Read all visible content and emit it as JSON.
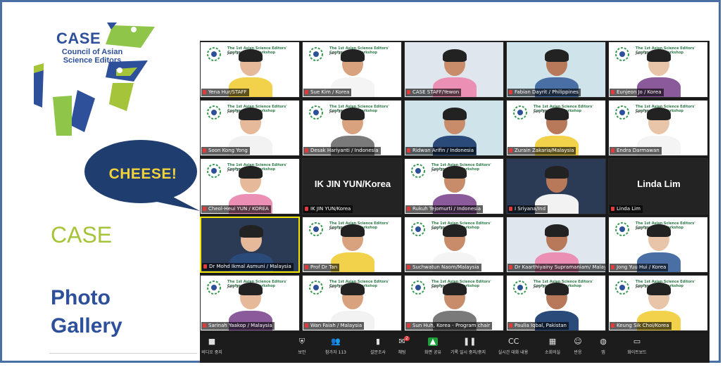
{
  "branding": {
    "logo_title": "CASE",
    "logo_subtitle": "Council of Asian Science Editors",
    "bubble_text": "CHEESE!",
    "case_heading": "CASE",
    "photo_line1": "Photo",
    "photo_line2": "Gallery"
  },
  "tiles": [
    {
      "name": "Yena Hur/STAFF",
      "kind": "slide",
      "speaker": false
    },
    {
      "name": "Sue Kim / Korea",
      "kind": "slide",
      "speaker": false
    },
    {
      "name": "CASE STAFF/Yewon",
      "kind": "photo",
      "speaker": false
    },
    {
      "name": "Fabian Dayrit / Philippines",
      "kind": "photo",
      "speaker": false
    },
    {
      "name": "Eunjeon Jo / Korea",
      "kind": "slide",
      "speaker": false
    },
    {
      "name": "Soon Kong Yong",
      "kind": "slide",
      "speaker": false
    },
    {
      "name": "Desak Hariyanti / Indonesia",
      "kind": "slide",
      "speaker": false
    },
    {
      "name": "Ridwan Arifin / Indonesia",
      "kind": "photo",
      "speaker": false
    },
    {
      "name": "Zurain Zakaria/Malaysia",
      "kind": "slide",
      "speaker": false
    },
    {
      "name": "Endra Darmawan",
      "kind": "slide",
      "speaker": false
    },
    {
      "name": "Cheol-Heui YUN / KOREA",
      "kind": "slide",
      "speaker": false
    },
    {
      "name": "IK JIN YUN/Korea",
      "kind": "dark",
      "speaker": false,
      "big": "IK JIN YUN/Korea"
    },
    {
      "name": "Rukuh Tejomurti / Indonesia",
      "kind": "slide",
      "speaker": false
    },
    {
      "name": "I Sriyana/Ind",
      "kind": "dark-photo",
      "speaker": false
    },
    {
      "name": "Linda Lim",
      "kind": "dark",
      "speaker": false,
      "big": "Linda Lim"
    },
    {
      "name": "Dr Mohd Ikmal Asmuni / Malaysia",
      "kind": "dark-photo",
      "speaker": true
    },
    {
      "name": "Prof Dr Tan",
      "kind": "slide",
      "speaker": false
    },
    {
      "name": "Suchwatun Naom/Malaysia",
      "kind": "slide",
      "speaker": false
    },
    {
      "name": "Dr Kaarthiyainy Supramaniam/ Malaysia",
      "kind": "photo",
      "speaker": false
    },
    {
      "name": "Jong Yuu Hui / Korea",
      "kind": "slide",
      "speaker": false
    },
    {
      "name": "Sarinah Yaakop / Malaysia",
      "kind": "slide",
      "speaker": false
    },
    {
      "name": "Wan Faiah / Malaysia",
      "kind": "slide",
      "speaker": false
    },
    {
      "name": "Sun Huh, Korea - Program chair",
      "kind": "slide",
      "speaker": false
    },
    {
      "name": "Paulia Iqbal, Pakistan",
      "kind": "slide",
      "speaker": false
    },
    {
      "name": "Keung Sik Choi/Korea",
      "kind": "slide",
      "speaker": false
    }
  ],
  "slide_text": {
    "header": "The 1st Asian Science Editors' Conference & Workshop",
    "date": "July 11, 2022",
    "small": "The 1st Asian Science Editors' Conference & Workshop"
  },
  "toolbar": {
    "items": [
      {
        "label": "비디오 중지",
        "icon": "video-icon",
        "glyph": "■"
      },
      {
        "label": "보안",
        "icon": "shield-icon",
        "glyph": "⛨"
      },
      {
        "label": "참가자 113",
        "icon": "participants-icon",
        "glyph": "👥"
      },
      {
        "label": "설문조사",
        "icon": "poll-icon",
        "glyph": "▮"
      },
      {
        "label": "채팅",
        "icon": "chat-icon",
        "glyph": "✉"
      },
      {
        "label": "화면 공유",
        "icon": "share-screen-icon",
        "glyph": "▲"
      },
      {
        "label": "기록 일시 중지/중지",
        "icon": "record-pause-icon",
        "glyph": "❚❚"
      },
      {
        "label": "실시간 대화 내용",
        "icon": "captions-icon",
        "glyph": "CC"
      },
      {
        "label": "소회의실",
        "icon": "breakout-icon",
        "glyph": "▦"
      },
      {
        "label": "반응",
        "icon": "reaction-icon",
        "glyph": "☺"
      },
      {
        "label": "앱",
        "icon": "apps-icon",
        "glyph": "◍"
      },
      {
        "label": "화이트보드",
        "icon": "whiteboard-icon",
        "glyph": "▭"
      }
    ],
    "chat_badge": "2"
  },
  "colors": {
    "brand_blue": "#2e4f9a",
    "brand_green": "#a6c43a",
    "speaker_border": "#f2e600",
    "share_green": "#1f9d3a"
  }
}
